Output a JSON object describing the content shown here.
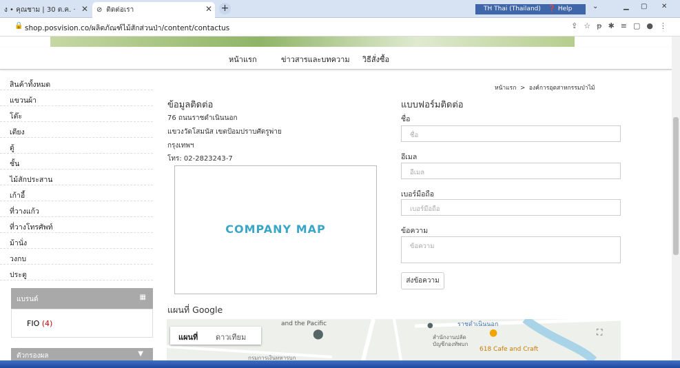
{
  "browser": {
    "tabs": [
      {
        "title": "ง • คุณชาม | 30 ต.ค. ·"
      },
      {
        "title": "ติดต่อเรา"
      }
    ],
    "url": "shop.posvision.co/ผลิตภัณฑ์ไม้สักส่วนป่า/content/contactus",
    "language": "TH Thai (Thailand)",
    "help": "Help"
  },
  "nav": {
    "items": [
      "หน้าแรก",
      "ข่าวสารและบทความ",
      "วิธีสั่งซื้อ"
    ]
  },
  "sidebar": {
    "items": [
      "สินค้าทั้งหมด",
      "แขวนผ้า",
      "โต๊ะ",
      "เตียง",
      "ตู้",
      "ชั้น",
      "ไม้สักประสาน",
      "เก้าอี้",
      "ที่วางแก้ว",
      "ที่วางโทรศัพท์",
      "ม้านั่ง",
      "วงกบ",
      "ประตู"
    ],
    "brand_header": "แบรนด์",
    "brand_item": "FIO",
    "brand_count": "(4)",
    "filter_header": "ตัวกรองผล"
  },
  "breadcrumb": {
    "home": "หน้าแรก",
    "sep": ">",
    "current": "องค์การอุตสาหกรรมป่าไม้"
  },
  "contact": {
    "heading": "ข้อมูลติดต่อ",
    "address1": "76 ถนนราชดำเนินนอก",
    "address2": "แขวงวัดโสมนัส เขตป้อมปราบศัตรูพ่าย",
    "address3": "กรุงเทพฯ",
    "phone": "โทร: 02-2823243-7",
    "map_label": "COMPANY MAP"
  },
  "form": {
    "heading": "แบบฟอร์มติดต่อ",
    "name_label": "ชื่อ",
    "name_placeholder": "ชื่อ",
    "email_label": "อีเมล",
    "email_placeholder": "อีเมล",
    "mobile_label": "เบอร์มือถือ",
    "mobile_placeholder": "เบอร์มือถือ",
    "message_label": "ข้อความ",
    "message_placeholder": "ข้อความ",
    "send_label": "ส่งข้อความ"
  },
  "gmap": {
    "heading": "แผนที่ Google",
    "map_tab": "แผนที่",
    "satellite_tab": "ดาวเทียม",
    "place1": "and the Pacific",
    "place2": "ราชดำเนินนอก",
    "place3": "สำนักงานปลัด",
    "place4": "บัญชีกองทัพบก",
    "place5": "618 Cafe and Craft",
    "place6": "กรมการเงินทหารบก"
  }
}
